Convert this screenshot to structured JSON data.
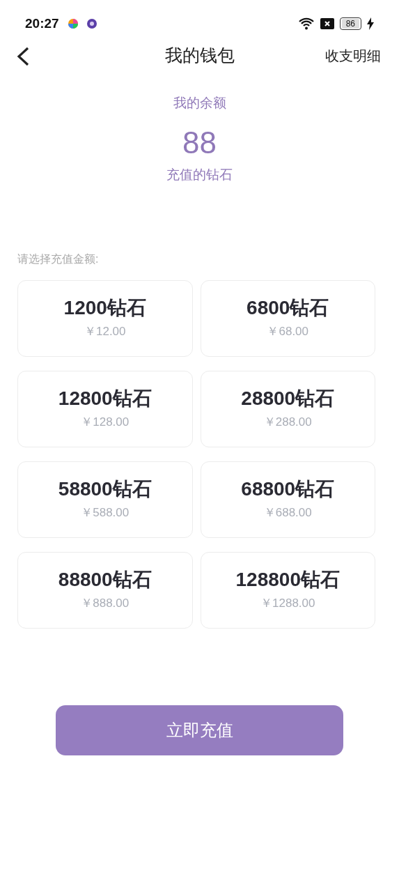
{
  "status_bar": {
    "time": "20:27",
    "battery": "86"
  },
  "nav": {
    "title": "我的钱包",
    "action": "收支明细"
  },
  "balance": {
    "label": "我的余额",
    "amount": "88",
    "unit": "充值的钻石"
  },
  "prompt": "请选择充值金额:",
  "options": [
    {
      "diamonds": "1200钻石",
      "price": "￥12.00",
      "selected": false
    },
    {
      "diamonds": "6800钻石",
      "price": "￥68.00",
      "selected": false
    },
    {
      "diamonds": "12800钻石",
      "price": "￥128.00",
      "selected": false
    },
    {
      "diamonds": "28800钻石",
      "price": "￥288.00",
      "selected": false
    },
    {
      "diamonds": "58800钻石",
      "price": "￥588.00",
      "selected": false
    },
    {
      "diamonds": "68800钻石",
      "price": "￥688.00",
      "selected": false
    },
    {
      "diamonds": "88800钻石",
      "price": "￥888.00",
      "selected": false
    },
    {
      "diamonds": "128800钻石",
      "price": "￥1288.00",
      "selected": false
    }
  ],
  "submit": "立即充值"
}
